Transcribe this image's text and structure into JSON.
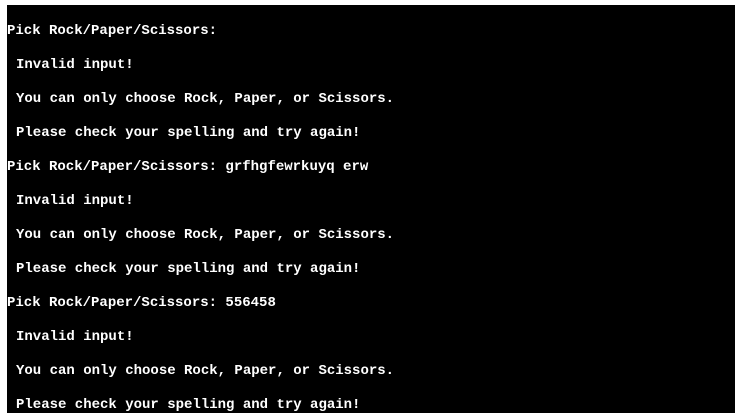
{
  "terminal": {
    "background": "#000000",
    "text_color": "#ffffff",
    "lines": [
      "Pick Rock/Paper/Scissors:",
      "Invalid input!",
      "You can only choose Rock, Paper, or Scissors.",
      "Please check your spelling and try again!",
      "Pick Rock/Paper/Scissors: grfhgfewrkuyq erw",
      "Invalid input!",
      "You can only choose Rock, Paper, or Scissors.",
      "Please check your spelling and try again!",
      "Pick Rock/Paper/Scissors: 556458",
      "Invalid input!",
      "You can only choose Rock, Paper, or Scissors.",
      "Please check your spelling and try again!"
    ]
  }
}
